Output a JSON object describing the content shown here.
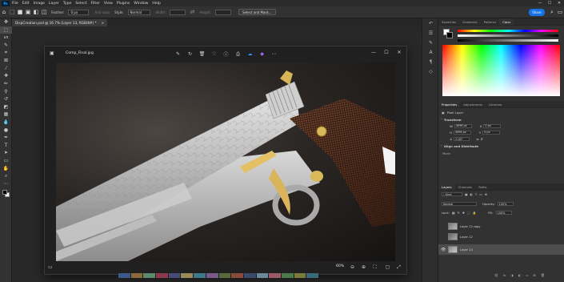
{
  "app": {
    "logo": "Ps"
  },
  "menu": [
    "File",
    "Edit",
    "Image",
    "Layer",
    "Type",
    "Select",
    "Filter",
    "View",
    "Plugins",
    "Window",
    "Help"
  ],
  "window_controls": [
    "—",
    "☐",
    "✕"
  ],
  "options_bar": {
    "feather_label": "Feather:",
    "feather_value": "0 px",
    "antialias_label": "Anti-alias",
    "style_label": "Style:",
    "style_value": "Normal",
    "width_label": "Width:",
    "height_label": "Height:",
    "select_mask": "Select and Mask...",
    "share": "Share"
  },
  "document_tab": {
    "title": "DispCreation.psd @ 16.7% (Layer 13, RGB/8#) *",
    "close": "×"
  },
  "viewer": {
    "filename": "Comp_Final.jpg",
    "zoom": "60%",
    "controls": [
      "—",
      "☐",
      "✕"
    ]
  },
  "swatch_tabs": [
    "Swatches",
    "Gradients",
    "Patterns",
    "Color"
  ],
  "color": {
    "fg": "#ffffff",
    "bg": "#000000"
  },
  "properties_tabs": [
    "Properties",
    "Adjustments",
    "Libraries"
  ],
  "properties": {
    "pixel_layer": "Pixel Layer",
    "transform": "Transform",
    "w_label": "W",
    "w_value": "4096 px",
    "x_label": "X",
    "x_value": "0 px",
    "h_label": "H",
    "h_value": "4096 px",
    "y_label": "Y",
    "y_value": "0 px",
    "angle_value": "0.00°",
    "align": "Align and Distribute",
    "more": "More:"
  },
  "layers_tabs": [
    "Layers",
    "Channels",
    "Paths"
  ],
  "layers_panel": {
    "kind": "Kind",
    "blend": "Normal",
    "opacity_label": "Opacity:",
    "opacity_value": "100%",
    "lock_label": "Lock:",
    "fill_label": "Fill:",
    "fill_value": "100%",
    "layers": [
      {
        "name": "Layer 12 copy",
        "visible": false,
        "selected": false
      },
      {
        "name": "Layer 12",
        "visible": false,
        "selected": false
      },
      {
        "name": "Layer 13",
        "visible": true,
        "selected": true
      }
    ]
  }
}
